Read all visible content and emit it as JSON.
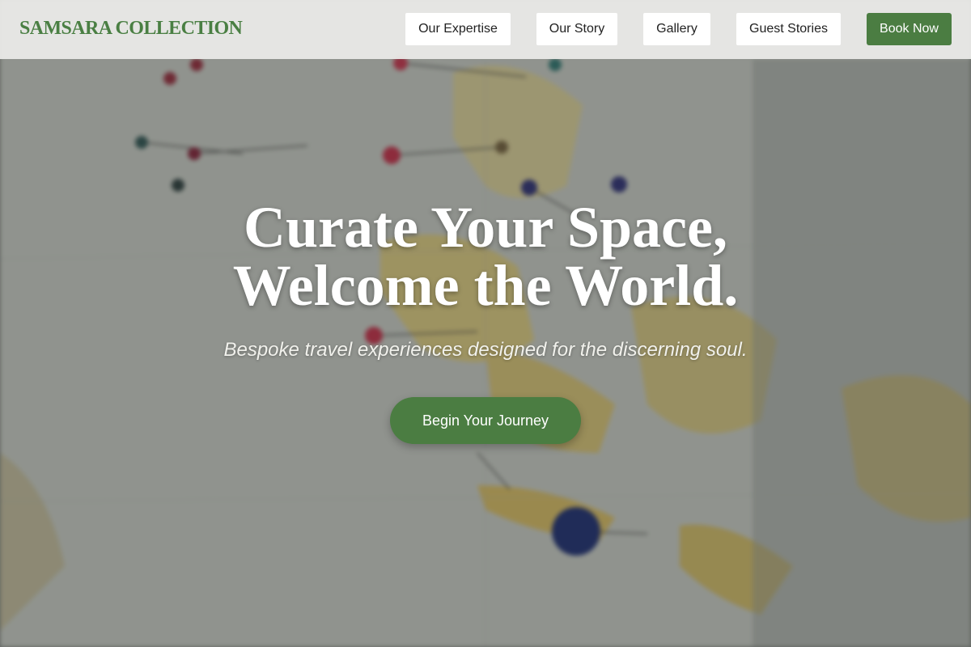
{
  "brand": {
    "name": "SAMSARA COLLECTION",
    "color": "#4a7f43"
  },
  "nav": {
    "items": [
      {
        "label": "Our Expertise"
      },
      {
        "label": "Our Story"
      },
      {
        "label": "Gallery"
      },
      {
        "label": "Guest Stories"
      }
    ],
    "book_label": "Book Now"
  },
  "hero": {
    "headline_line1": "Curate Your Space,",
    "headline_line2": "Welcome the World.",
    "tagline": "Bespoke travel experiences designed for the discerning soul.",
    "cta_label": "Begin Your Journey",
    "background": "map-with-pins-photo"
  },
  "colors": {
    "accent": "#4b7d42",
    "navbar_bg": "#ececea",
    "nav_button_bg": "#ffffff"
  }
}
